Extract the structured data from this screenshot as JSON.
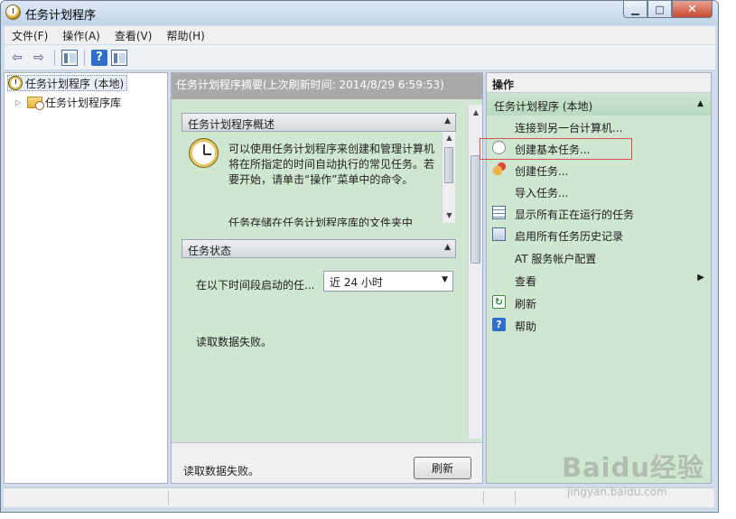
{
  "window": {
    "title": "任务计划程序",
    "buttons": {
      "minimize": "▁",
      "maximize": "□",
      "close": "✕"
    }
  },
  "menubar": {
    "items": [
      "文件(F)",
      "操作(A)",
      "查看(V)",
      "帮助(H)"
    ]
  },
  "toolbar": {
    "icons": [
      "back-arrow-icon",
      "forward-arrow-icon",
      "show-hide-tree-icon",
      "help-icon",
      "show-hide-action-pane-icon"
    ],
    "back_glyph": "⇦",
    "forward_glyph": "⇨",
    "help_glyph": "?"
  },
  "tree": {
    "root_label": "任务计划程序 (本地)",
    "child_label": "任务计划程序库",
    "expander": "▷"
  },
  "center": {
    "header": "任务计划程序摘要(上次刷新时间: 2014/8/29 6:59:53)",
    "overview": {
      "title": "任务计划程序概述",
      "text": "可以使用任务计划程序来创建和管理计算机将在所指定的时间自动执行的常见任务。若要开始，请单击“操作”菜单中的命令。",
      "text_partial": "任务存储在任务计划程序库的文件夹中"
    },
    "status": {
      "title": "任务状态",
      "filter_label": "在以下时间段启动的任...",
      "filter_value": "近 24 小时",
      "error": "读取数据失败。"
    },
    "footer": {
      "message": "读取数据失败。",
      "refresh_label": "刷新"
    },
    "glyphs": {
      "up": "▲",
      "down": "▼"
    }
  },
  "actions": {
    "title": "操作",
    "group_label": "任务计划程序 (本地)",
    "items": [
      {
        "label": "连接到另一台计算机...",
        "icon": "none"
      },
      {
        "label": "创建基本任务...",
        "icon": "clock-document-icon"
      },
      {
        "label": "创建任务...",
        "icon": "clock-star-icon"
      },
      {
        "label": "导入任务...",
        "icon": "none"
      },
      {
        "label": "显示所有正在运行的任务",
        "icon": "task-list-icon"
      },
      {
        "label": "启用所有任务历史记录",
        "icon": "history-icon"
      },
      {
        "label": "AT 服务帐户配置",
        "icon": "none"
      },
      {
        "label": "查看",
        "icon": "none",
        "submenu": "▶"
      },
      {
        "label": "刷新",
        "icon": "refresh-icon"
      },
      {
        "label": "帮助",
        "icon": "help-icon"
      }
    ]
  },
  "watermark": {
    "brand": "Baidu经验",
    "url": "jingyan.baidu.com"
  },
  "colors": {
    "pane_green": "#cfe6d0",
    "group_green": "#b9dbbf",
    "highlight_red": "#d9534a",
    "header_gray": "#a9a9a9"
  }
}
